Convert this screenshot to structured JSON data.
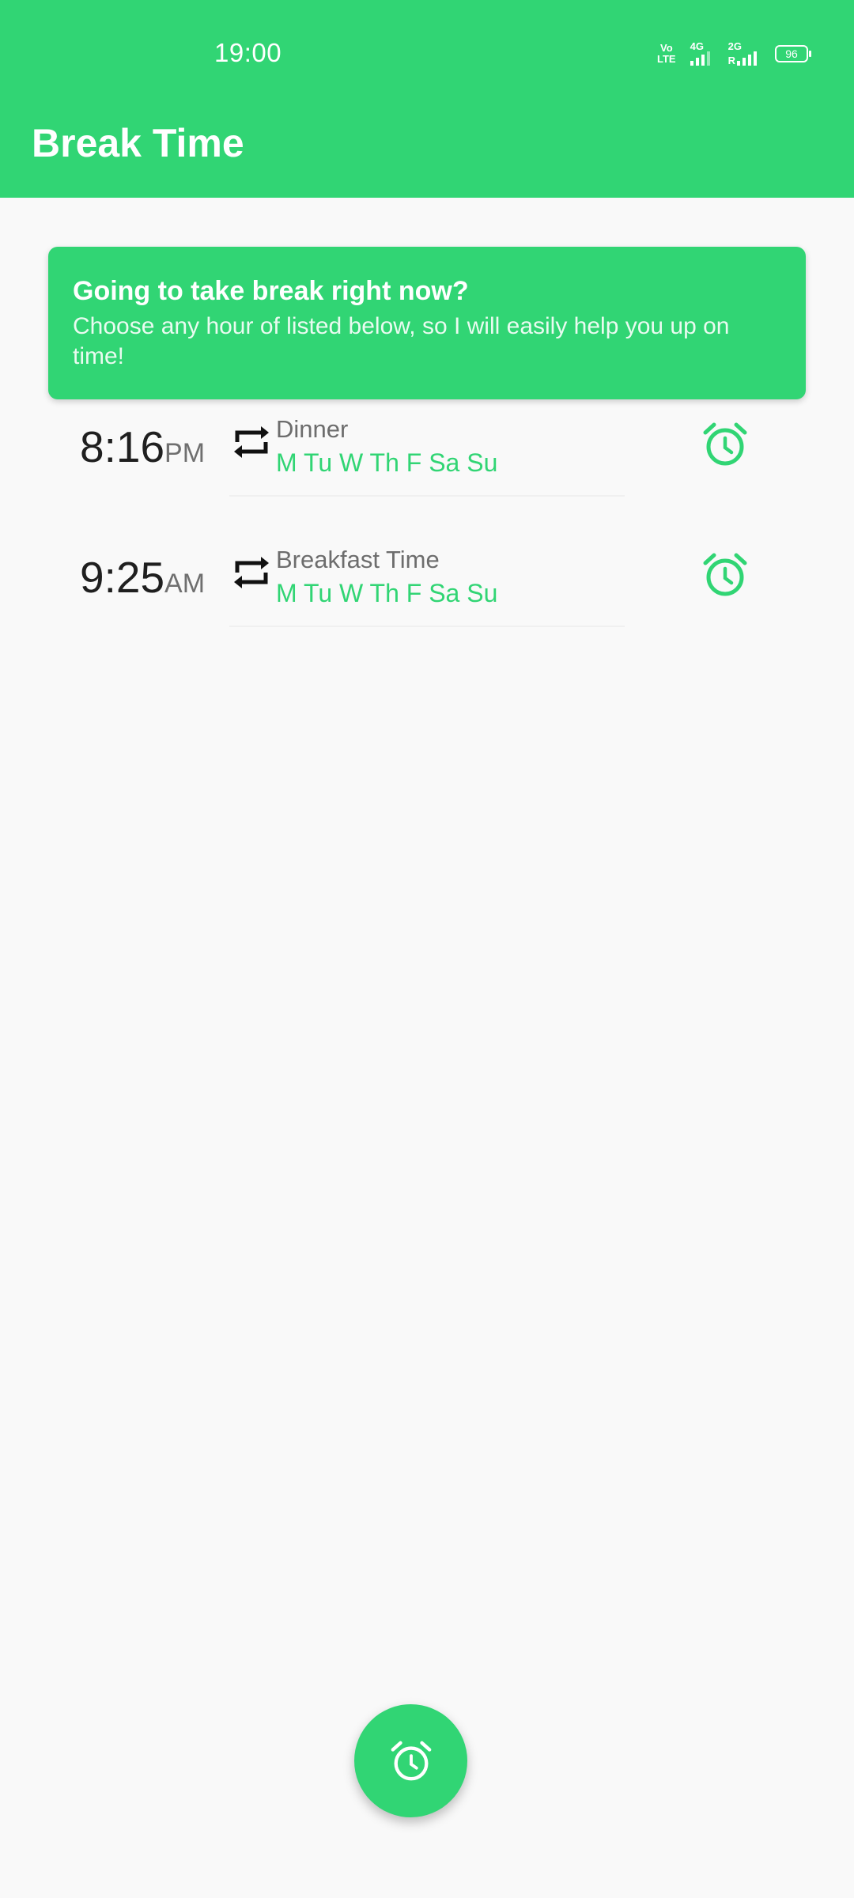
{
  "status_bar": {
    "time": "19:00",
    "volte_top": "Vo",
    "volte_bottom": "LTE",
    "network_1": "4G",
    "network_2": "2G",
    "network_2_sub": "R",
    "battery": "96"
  },
  "app_bar": {
    "title": "Break Time"
  },
  "banner": {
    "title": "Going to take break right now?",
    "subtitle": "Choose any hour of listed below, so I will easily help you up on time!"
  },
  "alarms": [
    {
      "time": "8:16",
      "period": "PM",
      "label": "Dinner",
      "days": "M Tu W Th F Sa Su",
      "repeat_icon": "repeat-icon",
      "alarm_icon": "alarm-clock-icon"
    },
    {
      "time": "9:25",
      "period": "AM",
      "label": "Breakfast Time",
      "days": "M Tu W Th F Sa Su",
      "repeat_icon": "repeat-icon",
      "alarm_icon": "alarm-clock-icon"
    }
  ],
  "fab": {
    "icon": "alarm-clock-icon"
  },
  "colors": {
    "accent": "#31d574",
    "background": "#f9f9f9",
    "text_primary": "#1f1f1f",
    "text_secondary": "#6d6d6d"
  }
}
